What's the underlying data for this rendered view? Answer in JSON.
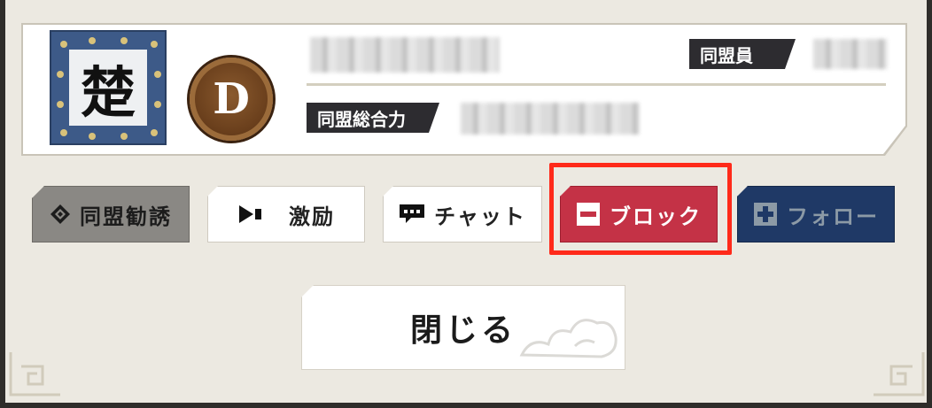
{
  "profile": {
    "emblem_char": "楚",
    "rank_letter": "D",
    "members_label": "同盟員",
    "power_label": "同盟総合力"
  },
  "actions": {
    "invite_label": "同盟勧誘",
    "cheer_label": "激励",
    "chat_label": "チャット",
    "block_label": "ブロック",
    "follow_label": "フォロー"
  },
  "close_label": "閉じる",
  "colors": {
    "block_red": "#c43246",
    "follow_navy": "#1f3966",
    "highlight": "#ff2a1a"
  }
}
